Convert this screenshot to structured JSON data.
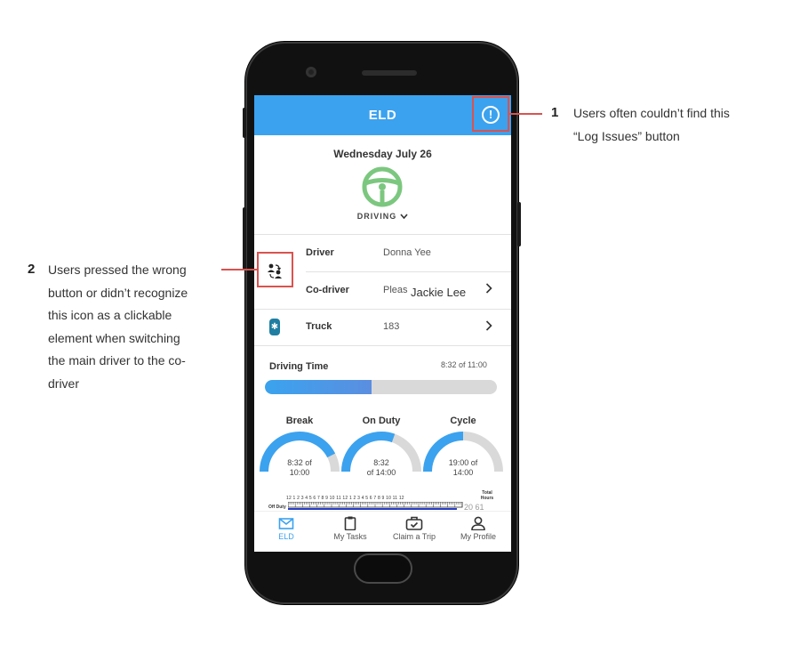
{
  "app": {
    "title": "ELD",
    "date": "Wednesday July 26",
    "status": "DRIVING"
  },
  "rows": {
    "driver": {
      "label": "Driver",
      "value": "Donna Yee"
    },
    "codriver": {
      "label": "Co-driver",
      "value": "Pleas",
      "overlay": "Jackie Lee"
    },
    "truck": {
      "label": "Truck",
      "value": "183"
    }
  },
  "driving_time": {
    "label": "Driving Time",
    "value": "8:32 of 11:00",
    "progress_fraction": 0.46
  },
  "gauges": [
    {
      "title": "Break",
      "line1": "8:32 of",
      "line2": "10:00",
      "fraction": 0.85
    },
    {
      "title": "On Duty",
      "line1": "8:32",
      "line2": "of 14:00",
      "fraction": 0.61
    },
    {
      "title": "Cycle",
      "line1": "19:00 of",
      "line2": "14:00",
      "fraction": 0.5
    }
  ],
  "log_chart": {
    "row_label": "Off Duty",
    "hours": "12 1 2 3 4 5 6 7 8 9 10 11 12 1 2 3 4 5 6 7 8 9 10 11 12",
    "total_header": "Total Hours",
    "total_value": "20 61"
  },
  "tabs": [
    {
      "label": "ELD",
      "icon": "envelope-icon",
      "active": true
    },
    {
      "label": "My Tasks",
      "icon": "clipboard-icon",
      "active": false
    },
    {
      "label": "Claim a Trip",
      "icon": "briefcase-check-icon",
      "active": false
    },
    {
      "label": "My Profile",
      "icon": "person-icon",
      "active": false
    }
  ],
  "annotations": [
    {
      "number": "1",
      "text_line1": "Users often couldn’t find this",
      "text_line2": "“Log Issues” button"
    },
    {
      "number": "2",
      "lines": [
        "Users pressed the wrong",
        "button or didn’t recognize",
        "this icon as a clickable",
        "element when switching",
        "the main driver to the co-",
        "driver"
      ]
    }
  ],
  "colors": {
    "accent": "#3ba2ef",
    "wheel": "#7cc77f",
    "annotation": "#d9534f",
    "bluetooth": "#1f7ea1"
  }
}
